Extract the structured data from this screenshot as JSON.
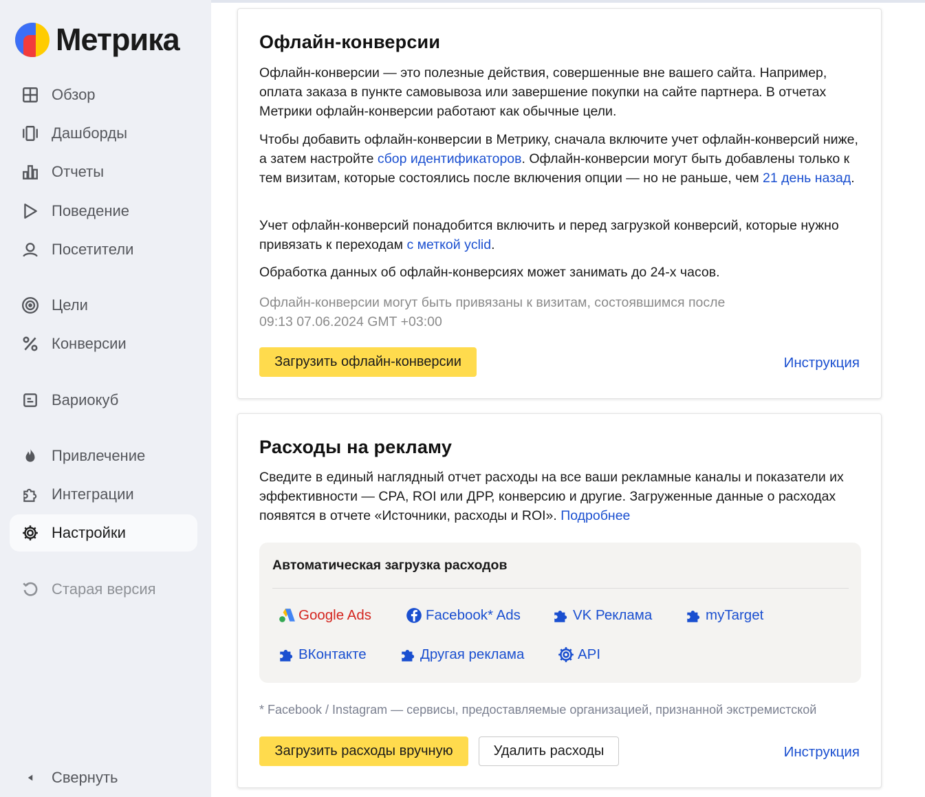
{
  "app": {
    "logo_text": "Метрика"
  },
  "sidebar": {
    "items": [
      {
        "label": "Обзор",
        "icon": "grid-icon"
      },
      {
        "label": "Дашборды",
        "icon": "dashboards-icon"
      },
      {
        "label": "Отчеты",
        "icon": "reports-icon"
      },
      {
        "label": "Поведение",
        "icon": "play-icon"
      },
      {
        "label": "Посетители",
        "icon": "user-icon"
      },
      {
        "label": "Цели",
        "icon": "target-icon"
      },
      {
        "label": "Конверсии",
        "icon": "percent-icon"
      },
      {
        "label": "Вариокуб",
        "icon": "variocube-icon"
      },
      {
        "label": "Привлечение",
        "icon": "fire-icon"
      },
      {
        "label": "Интеграции",
        "icon": "puzzle-icon"
      },
      {
        "label": "Настройки",
        "icon": "gear-icon",
        "active": true
      },
      {
        "label": "Старая версия",
        "icon": "undo-icon"
      }
    ],
    "collapse_label": "Свернуть"
  },
  "offline": {
    "title": "Офлайн-конверсии",
    "p1": "Офлайн-конверсии — это полезные действия, совершенные вне вашего сайта. Например, оплата заказа в пункте самовывоза или завершение покупки на сайте партнера. В отчетах Метрики офлайн-конверсии работают как обычные цели.",
    "p2_a": "Чтобы добавить офлайн-конверсии в Метрику, сначала включите учет офлайн-конверсий ниже, а затем настройте ",
    "p2_link1": "сбор идентификаторов",
    "p2_b": ". Офлайн-конверсии могут быть добавлены только к тем визитам, которые состоялись после включения опции — но не раньше, чем ",
    "p2_link2": "21 день назад",
    "p2_c": ".",
    "p3_a": "Учет офлайн-конверсий понадобится включить и перед загрузкой конверсий, которые нужно привязать к переходам ",
    "p3_link": "с меткой yclid",
    "p3_b": ".",
    "p4": "Обработка данных об офлайн-конверсиях может занимать до 24-х часов.",
    "note_line1": "Офлайн-конверсии могут быть привязаны к визитам, состоявшимся после",
    "note_line2": "09:13 07.06.2024 GMT +03:00",
    "upload_button": "Загрузить офлайн-конверсии",
    "instruction_link": "Инструкция"
  },
  "ads": {
    "title": "Расходы на рекламу",
    "p1_a": "Сведите в единый наглядный отчет расходы на все ваши рекламные каналы и показатели их эффективности — CPA, ROI или ДРР, конверсию и другие. Загруженные данные о расходах появятся в отчете «Источники, расходы и ROI». ",
    "p1_link": "Подробнее",
    "auto_title": "Автоматическая загрузка расходов",
    "services": [
      {
        "label": "Google Ads",
        "icon": "google-ads-icon"
      },
      {
        "label": "Facebook* Ads",
        "icon": "facebook-icon"
      },
      {
        "label": "VK Реклама",
        "icon": "puzzle-icon"
      },
      {
        "label": "myTarget",
        "icon": "puzzle-icon"
      },
      {
        "label": "ВКонтакте",
        "icon": "puzzle-icon"
      },
      {
        "label": "Другая реклама",
        "icon": "puzzle-icon"
      },
      {
        "label": "API",
        "icon": "gear-icon"
      }
    ],
    "footnote": "* Facebook / Instagram — сервисы, предоставляемые организацией, признанной экстремистской",
    "manual_button": "Загрузить расходы вручную",
    "delete_button": "Удалить расходы",
    "instruction_link": "Инструкция"
  },
  "colors": {
    "accent_yellow": "#ffdb4d",
    "link_blue": "#1a4fd0",
    "sidebar_bg": "#eef0f5"
  }
}
